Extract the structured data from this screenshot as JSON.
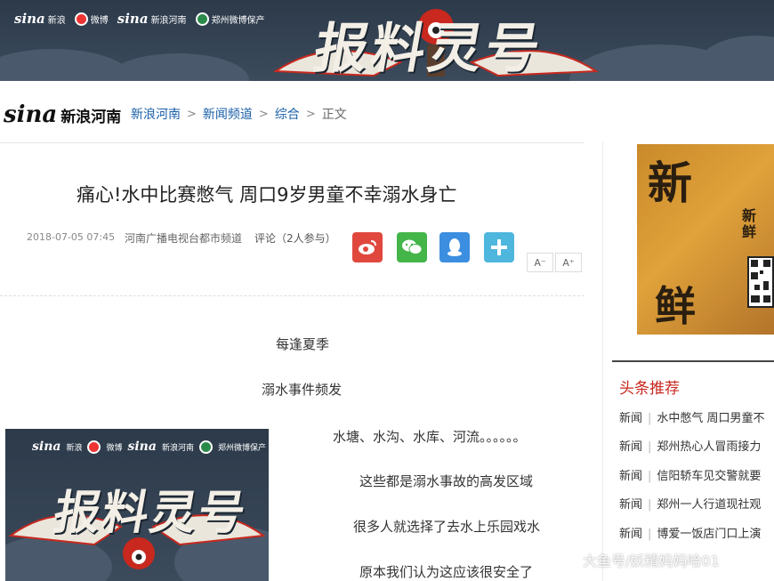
{
  "banner": {
    "brands": [
      "新浪",
      "微博",
      "新浪河南",
      "郑州微博保产"
    ],
    "sina_mark": "sina",
    "title": "报料灵号"
  },
  "header": {
    "logo_mark": "sina",
    "site_name": "新浪河南",
    "breadcrumb": [
      "新浪河南",
      "新闻频道",
      "综合"
    ],
    "current": "正文"
  },
  "article": {
    "title": "痛心!水中比赛憋气 周口9岁男童不幸溺水身亡",
    "time": "2018-07-05 07:45",
    "source": "河南广播电视台都市频道",
    "comment": "评论（2人参与）",
    "font_minus": "A⁻",
    "font_plus": "A⁺",
    "paragraphs": [
      "每逢夏季",
      "溺水事件频发",
      "水塘、水沟、水库、河流。。。。。。",
      "这些都是溺水事故的高发区域",
      "很多人就选择了去水上乐园戏水",
      "原本我们认为这应该很安全了"
    ],
    "image_brands": [
      "新浪",
      "微博",
      "新浪河南",
      "郑州微博保产"
    ],
    "image_title": "报料灵号"
  },
  "sidebar": {
    "ad_lines": [
      "新",
      "鲜"
    ],
    "ad_small": "新鲜",
    "heading": "头条推荐",
    "items": [
      {
        "cat": "新闻",
        "text": "水中憋气 周口男童不"
      },
      {
        "cat": "新闻",
        "text": "郑州热心人冒雨接力"
      },
      {
        "cat": "新闻",
        "text": "信阳轿车见交警就要"
      },
      {
        "cat": "新闻",
        "text": "郑州一人行道现社观"
      },
      {
        "cat": "新闻",
        "text": "博爱一饭店门口上演"
      }
    ]
  },
  "watermark": "大鱼号/妖精妈妈哈01"
}
